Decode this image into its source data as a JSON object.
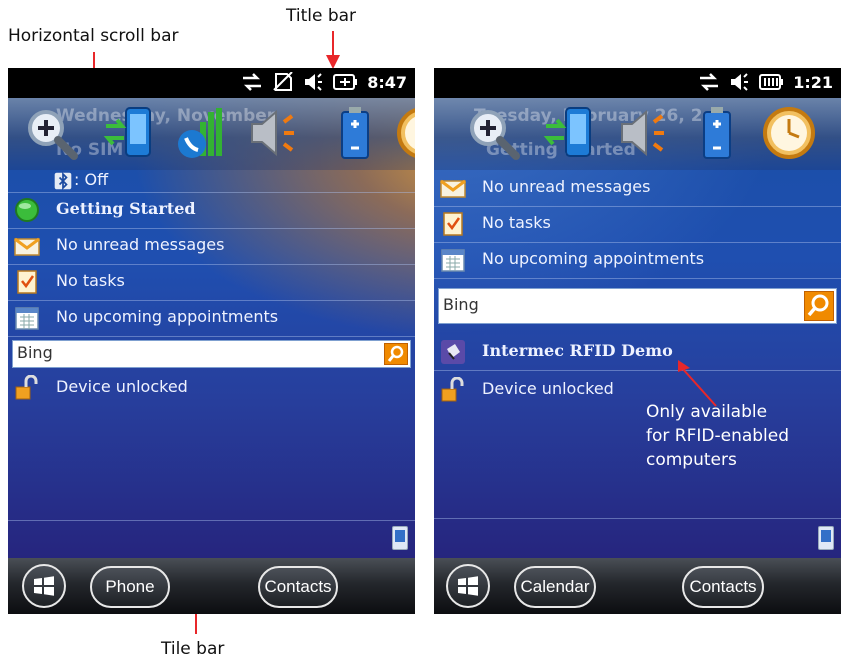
{
  "callouts": {
    "title_bar": "Title bar",
    "horizontal_scroll_bar": "Horizontal scroll bar",
    "tile_bar": "Tile bar"
  },
  "left_screen": {
    "status": {
      "time": "8:47",
      "icons": [
        "connection-icon",
        "no-sim-icon",
        "volume-icon",
        "battery-charging-icon"
      ]
    },
    "ghost_text": [
      "Wednesday, November",
      "No SIM"
    ],
    "tiles": [
      "zoom-icon",
      "data-connection-icon",
      "signal-phone-icon",
      "volume-icon",
      "battery-icon",
      "clock-icon"
    ],
    "bluetooth_status": ": Off",
    "items": [
      {
        "icon": "getting-started-icon",
        "label": "Getting Started"
      },
      {
        "icon": "messages-icon",
        "label": "No unread messages"
      },
      {
        "icon": "tasks-icon",
        "label": "No tasks"
      },
      {
        "icon": "calendar-icon",
        "label": "No upcoming appointments"
      }
    ],
    "search": {
      "value": "Bing"
    },
    "lock": {
      "label": "Device unlocked"
    },
    "softkeys": {
      "left": "Phone",
      "right": "Contacts"
    }
  },
  "right_screen": {
    "status": {
      "time": "1:21",
      "icons": [
        "connection-icon",
        "volume-icon",
        "battery-icon"
      ]
    },
    "ghost_text": [
      "Tuesday, February 26, 2",
      "Getting Started"
    ],
    "tiles": [
      "zoom-icon",
      "data-connection-icon",
      "volume-icon",
      "battery-icon",
      "clock-icon"
    ],
    "items": [
      {
        "icon": "messages-icon",
        "label": "No unread messages"
      },
      {
        "icon": "tasks-icon",
        "label": "No tasks"
      },
      {
        "icon": "calendar-icon",
        "label": "No upcoming appointments"
      }
    ],
    "search": {
      "value": "Bing"
    },
    "rfid": {
      "label": "Intermec RFID Demo"
    },
    "lock": {
      "label": "Device unlocked"
    },
    "note": {
      "line1": "Only available",
      "line2": "for RFID-enabled",
      "line3": "computers"
    },
    "softkeys": {
      "left": "Calendar",
      "right": "Contacts"
    }
  },
  "colors": {
    "accent": "#e8272a",
    "search_button": "#f08a00"
  }
}
